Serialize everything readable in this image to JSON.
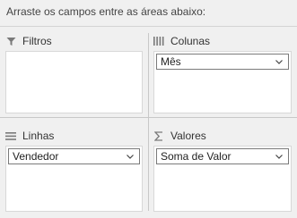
{
  "instruction": "Arraste os campos entre as áreas abaixo:",
  "areas": {
    "filters": {
      "title": "Filtros",
      "icon": "filter-icon",
      "fields": []
    },
    "columns": {
      "title": "Colunas",
      "icon": "columns-icon",
      "fields": [
        {
          "label": "Mês"
        }
      ]
    },
    "rows": {
      "title": "Linhas",
      "icon": "rows-icon",
      "fields": [
        {
          "label": "Vendedor"
        }
      ]
    },
    "values": {
      "title": "Valores",
      "icon": "sigma-icon",
      "fields": [
        {
          "label": "Soma de Valor"
        }
      ]
    }
  },
  "colors": {
    "panel_background": "#f0f0f0",
    "box_background": "#ffffff",
    "pill_border": "#7a7a7a"
  }
}
